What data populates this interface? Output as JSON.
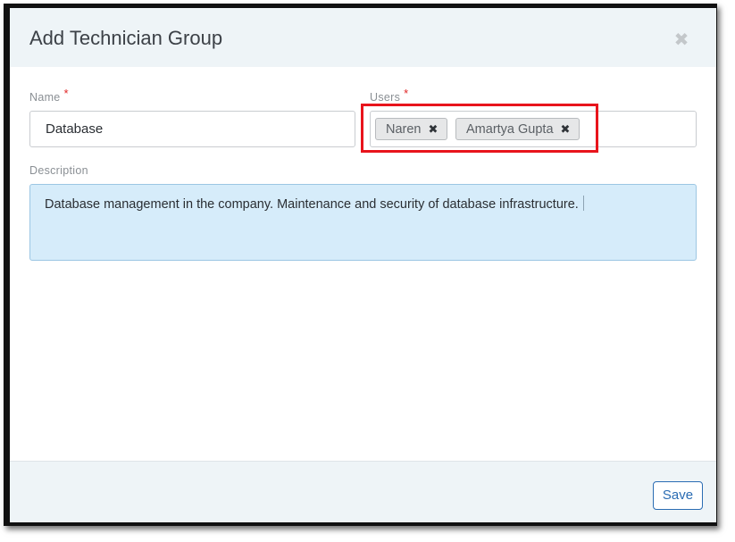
{
  "dialog": {
    "title": "Add Technician Group",
    "close_icon": "close-icon"
  },
  "form": {
    "name": {
      "label": "Name",
      "required_marker": "*",
      "value": "Database"
    },
    "users": {
      "label": "Users",
      "required_marker": "*",
      "selected": [
        {
          "label": "Naren",
          "remove_icon": "remove-tag-icon"
        },
        {
          "label": "Amartya Gupta",
          "remove_icon": "remove-tag-icon"
        }
      ]
    },
    "description": {
      "label": "Description",
      "value": "Database management in the company. Maintenance and security of database infrastructure."
    }
  },
  "footer": {
    "save_label": "Save"
  },
  "colors": {
    "highlight_box": "#e8141c",
    "required_star": "#e02424",
    "save_button": "#2a6cb3",
    "description_bg": "#d6ecfa",
    "header_bg": "#eef4f7"
  }
}
